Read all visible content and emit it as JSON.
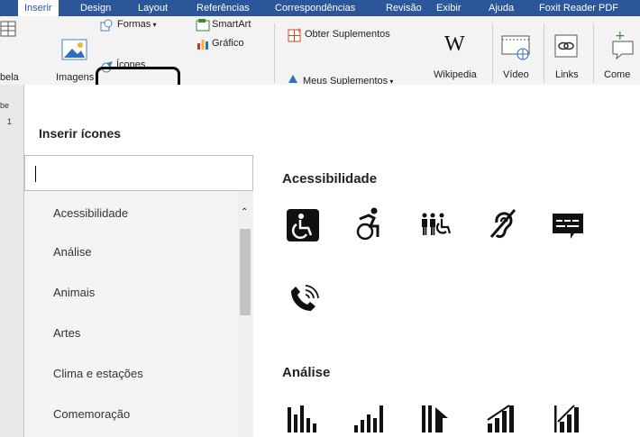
{
  "ribbon_tabs": [
    "Inserir",
    "Design",
    "Layout",
    "Referências",
    "Correspondências",
    "Revisão",
    "Exibir",
    "Ajuda",
    "Foxit Reader PDF"
  ],
  "ribbon": {
    "tabela_label": "bela",
    "imagens_label": "Imagens",
    "formas_label": "Formas",
    "icones_label": "Ícones",
    "smartart_label": "SmartArt",
    "grafico_label": "Gráfico",
    "obter_suplementos_label": "Obter Suplementos",
    "meus_suplementos_label": "Meus Suplementos",
    "wikipedia_label": "Wikipedia",
    "video_label": "Vídeo",
    "links_label": "Links",
    "comentario_label": "Come"
  },
  "doc_strip": {
    "line1": "be",
    "line2": "1"
  },
  "dialog": {
    "title": "Inserir ícones",
    "search_value": "",
    "categories": [
      "Acessibilidade",
      "Análise",
      "Animais",
      "Artes",
      "Clima e estações",
      "Comemoração"
    ],
    "sections": [
      {
        "title": "Acessibilidade",
        "icons": [
          "wheelchair-square-icon",
          "running-wheelchair-icon",
          "family-wheelchair-icon",
          "hearing-impaired-icon",
          "closed-caption-icon",
          "phone-volume-icon"
        ]
      },
      {
        "title": "Análise",
        "icons": [
          "bar-chart-icon",
          "bar-chart-rising-icon",
          "bar-chart-arrow-icon",
          "bar-chart-trend-up-icon",
          "bar-chart-growth-icon"
        ]
      }
    ]
  },
  "colors": {
    "ribbon_blue": "#2b579a",
    "highlight_border": "#000000"
  }
}
